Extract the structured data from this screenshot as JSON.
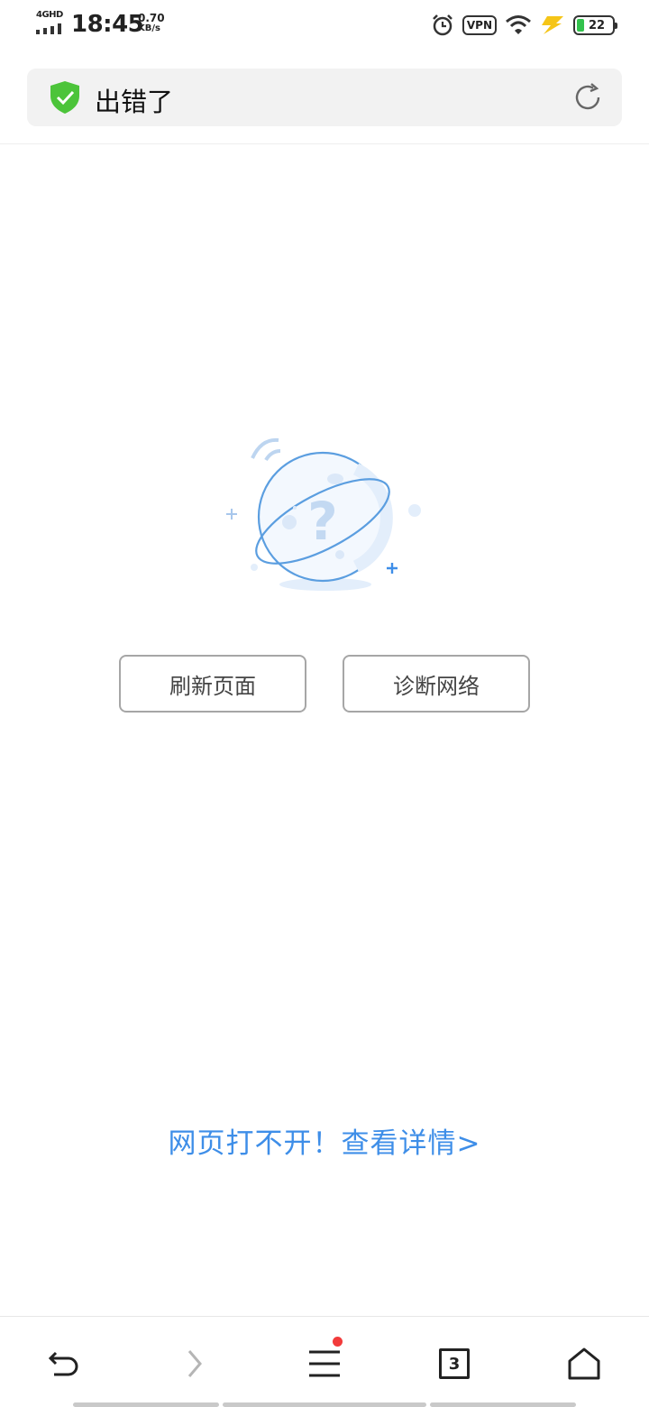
{
  "status_bar": {
    "network": "4GHD",
    "time": "18:45",
    "speed_value": "0.70",
    "speed_unit": "KB/s",
    "vpn": "VPN",
    "battery": "22"
  },
  "address_bar": {
    "title": "出错了"
  },
  "error_page": {
    "illustration_icon": "question-planet-icon",
    "refresh_label": "刷新页面",
    "diagnose_label": "诊断网络",
    "help_link": "网页打不开！查看详情>"
  },
  "bottom_nav": {
    "tab_count": "3",
    "menu_has_notification": true
  },
  "colors": {
    "accent": "#3e8ee8",
    "shield": "#4cc43a",
    "notification": "#f23b3b",
    "illustration": "#5b9ee0"
  }
}
